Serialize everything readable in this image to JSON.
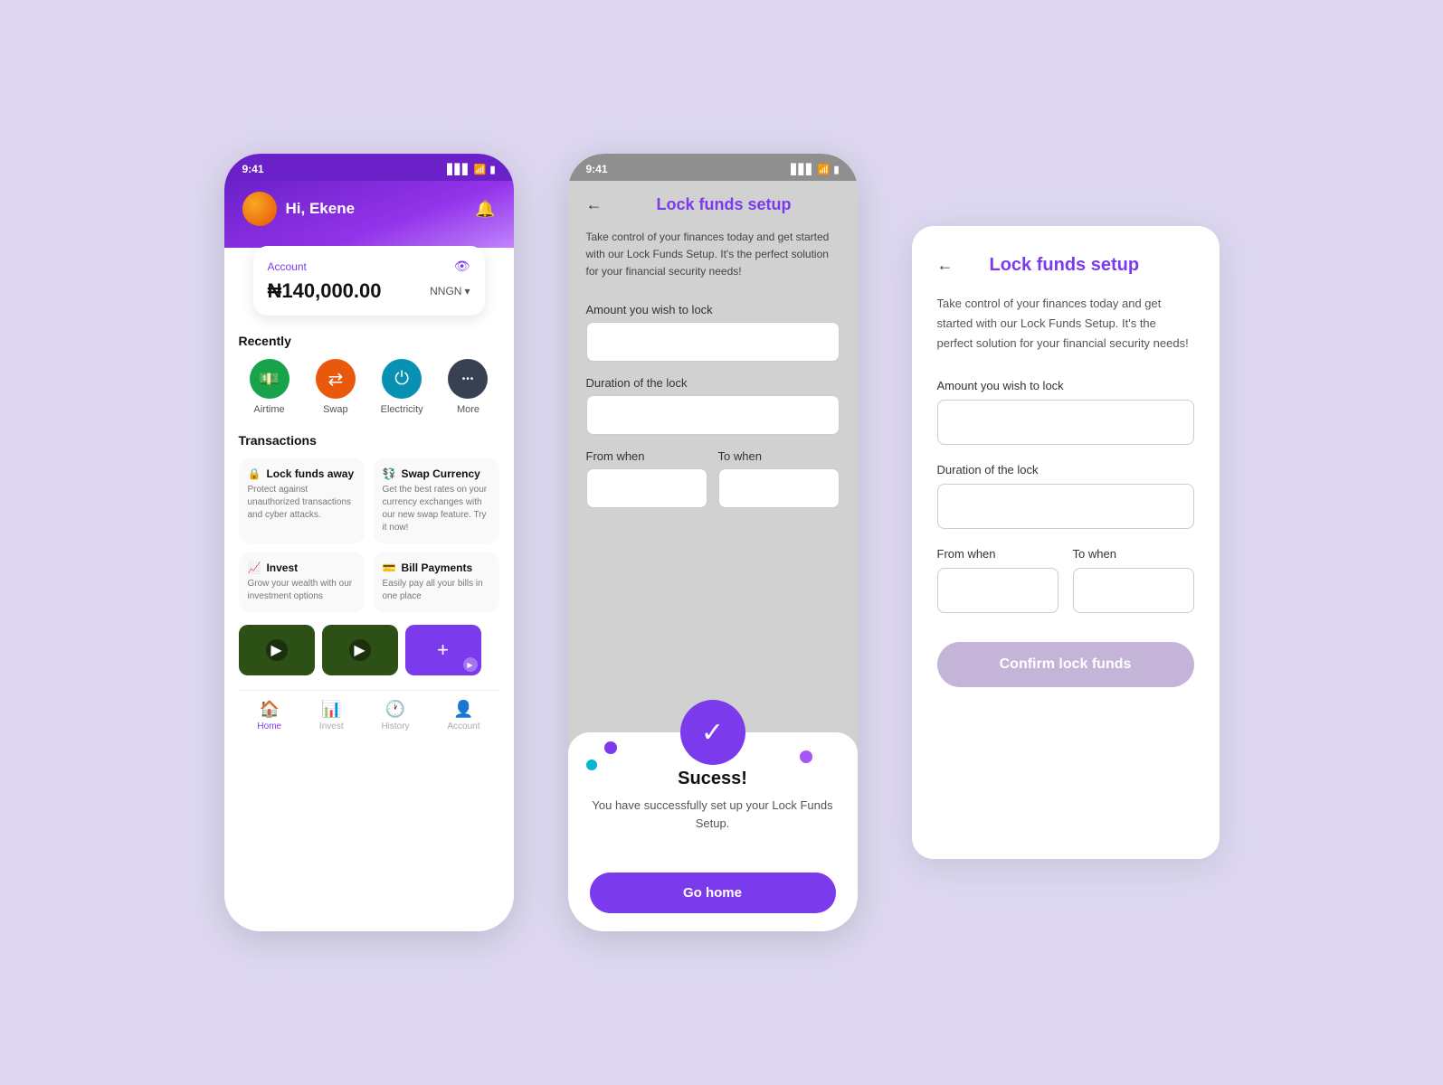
{
  "background": "#ddd8f0",
  "phone1": {
    "status": {
      "time": "9:41",
      "signal": "▋▋▋",
      "wifi": "WiFi",
      "battery": "🔋"
    },
    "greeting": "Hi, Ekene",
    "account": {
      "label": "Account",
      "balance": "₦140,000.00",
      "currency": "NNGN"
    },
    "sections": {
      "recently": "Recently",
      "transactions": "Transactions"
    },
    "quickActions": [
      {
        "id": "airtime",
        "label": "Airtime",
        "icon": "💵",
        "color": "green"
      },
      {
        "id": "swap",
        "label": "Swap",
        "icon": "⇄",
        "color": "orange"
      },
      {
        "id": "electricity",
        "label": "Electricity",
        "icon": "⏻",
        "color": "cyan"
      },
      {
        "id": "more",
        "label": "More",
        "icon": "•••",
        "color": "gray"
      }
    ],
    "transCards": [
      {
        "id": "lock",
        "icon": "🔒",
        "title": "Lock funds away",
        "desc": "Protect against unauthorized transactions and cyber attacks."
      },
      {
        "id": "swap",
        "icon": "💱",
        "title": "Swap Currency",
        "desc": "Get the best rates on your currency exchanges with our new swap feature. Try it now!"
      },
      {
        "id": "invest",
        "icon": "📈",
        "title": "Invest",
        "desc": "Grow your wealth with our investment options"
      },
      {
        "id": "bills",
        "icon": "💳",
        "title": "Bill Payments",
        "desc": "Easily pay all your bills in one place"
      }
    ],
    "nav": [
      {
        "id": "home",
        "label": "Home",
        "icon": "🏠",
        "active": true
      },
      {
        "id": "invest",
        "label": "Invest",
        "icon": "📊",
        "active": false
      },
      {
        "id": "history",
        "label": "History",
        "icon": "🕐",
        "active": false
      },
      {
        "id": "account",
        "label": "Account",
        "icon": "👤",
        "active": false
      }
    ]
  },
  "phone2": {
    "status": {
      "time": "9:41",
      "signal": "▋▋▋",
      "battery": "🔋"
    },
    "title": "Lock funds setup",
    "desc": "Take control of your finances today and get started with our Lock Funds Setup. It's the perfect solution for your financial security needs!",
    "form": {
      "amountLabel": "Amount you wish to lock",
      "durationLabel": "Duration of the lock",
      "fromLabel": "From when",
      "toLabel": "To when"
    },
    "success": {
      "title": "Sucess!",
      "desc": "You have successfully set up your Lock Funds Setup.",
      "buttonLabel": "Go home"
    }
  },
  "panel3": {
    "title": "Lock funds setup",
    "desc": "Take control of your finances today and get started with our Lock Funds Setup. It's the perfect solution for your financial security needs!",
    "form": {
      "amountLabel": "Amount you wish to lock",
      "durationLabel": "Duration of the lock",
      "fromLabel": "From when",
      "toLabel": "To when"
    },
    "confirmButton": "Confirm lock funds"
  }
}
